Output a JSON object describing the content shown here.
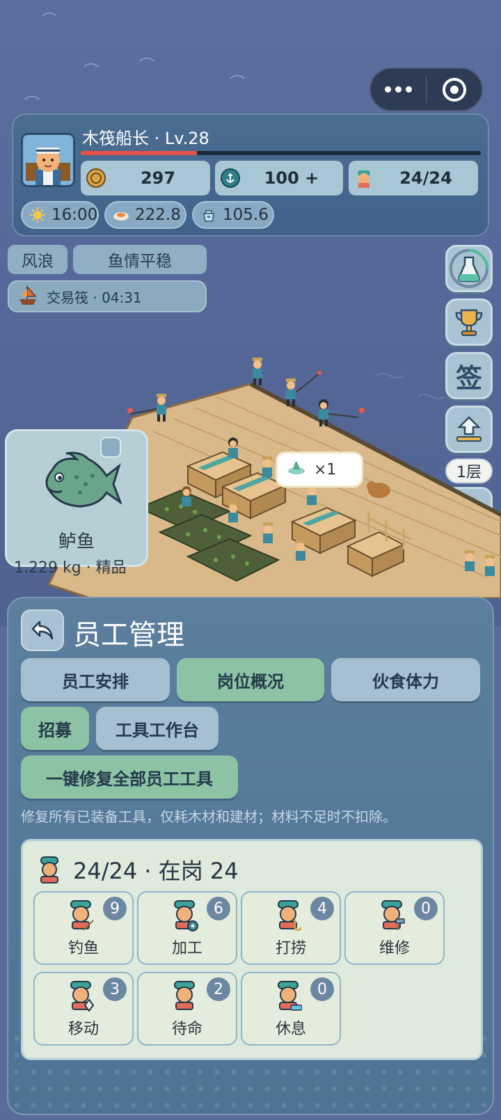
{
  "player": {
    "name": "木筏船长 · Lv.28",
    "xp_progress": 0.29,
    "coins": "297",
    "anchor": "100 +",
    "staff": "24/24",
    "time": "16:00",
    "food": "222.8",
    "water": "105.6"
  },
  "weather": {
    "label": "风浪",
    "status": "鱼情平稳"
  },
  "trade": {
    "label": "交易筏 · 04:31"
  },
  "side": {
    "sign_label": "签",
    "floor_label": "1层"
  },
  "toast": {
    "text": "×1"
  },
  "fish_card": {
    "name": "鲈鱼",
    "info": "1.229 kg · 精品"
  },
  "staff_panel": {
    "title": "员工管理",
    "tabs": [
      "员工安排",
      "岗位概况",
      "伙食体力"
    ],
    "recruit_label": "招募",
    "workbench_label": "工具工作台",
    "repair_all_label": "一键修复全部员工工具",
    "repair_note": "修复所有已装备工具，仅耗木材和建材；材料不足时不扣除。",
    "summary": "24/24 · 在岗 24",
    "roles": [
      {
        "label": "钓鱼",
        "count": "9"
      },
      {
        "label": "加工",
        "count": "6"
      },
      {
        "label": "打捞",
        "count": "4"
      },
      {
        "label": "维修",
        "count": "0"
      },
      {
        "label": "移动",
        "count": "3"
      },
      {
        "label": "待命",
        "count": "2"
      },
      {
        "label": "休息",
        "count": "0"
      }
    ]
  },
  "colors": {
    "accent_green": "#8cc3a5",
    "xp_red": "#e5524a",
    "panel_blue": "#4e7394"
  }
}
